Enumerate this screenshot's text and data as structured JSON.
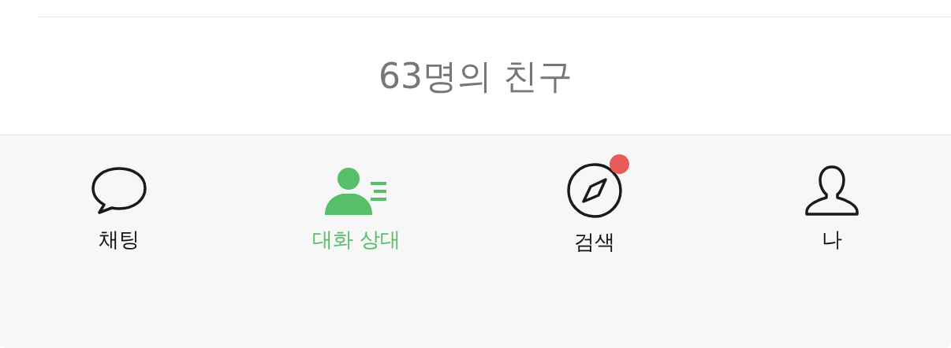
{
  "friend_count": "63명의 친구",
  "tabs": [
    {
      "kind": "chats",
      "label": "채팅",
      "selected": false,
      "badge": false
    },
    {
      "kind": "contacts",
      "label": "대화 상대",
      "selected": true,
      "badge": false
    },
    {
      "kind": "discover",
      "label": "검색",
      "selected": false,
      "badge": true
    },
    {
      "kind": "me",
      "label": "나",
      "selected": false,
      "badge": false
    }
  ]
}
